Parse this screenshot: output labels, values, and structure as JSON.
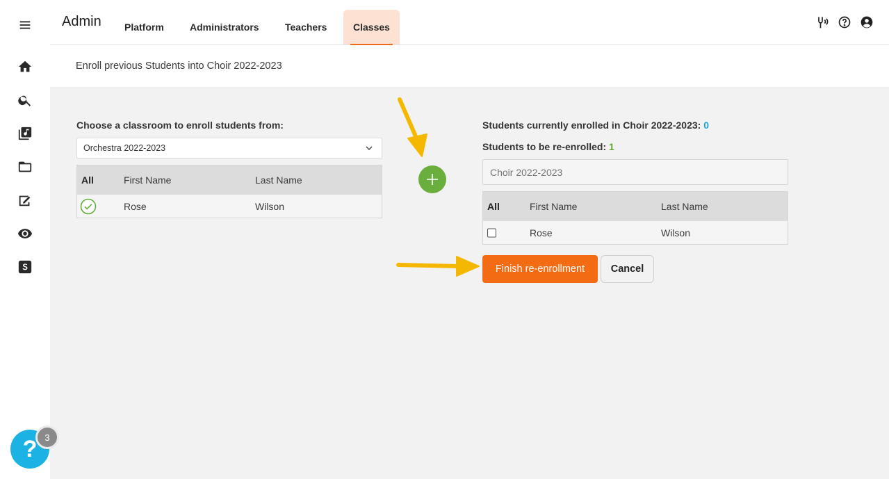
{
  "header": {
    "brand": "Admin",
    "tabs": [
      {
        "label": "Platform"
      },
      {
        "label": "Administrators"
      },
      {
        "label": "Teachers"
      },
      {
        "label": "Classes",
        "active": true
      }
    ],
    "icons": [
      "tuning-fork-icon",
      "help-circle-icon",
      "account-icon"
    ]
  },
  "sidebar": {
    "icons": [
      "menu-icon",
      "home-icon",
      "search-icon",
      "music-library-icon",
      "folder-icon",
      "assignment-icon",
      "eye-icon",
      "s-logo-icon"
    ]
  },
  "subheader": {
    "title": "Enroll previous Students into Choir 2022-2023"
  },
  "left_panel": {
    "heading": "Choose a classroom to enroll students from:",
    "select_value": "Orchestra 2022-2023",
    "table": {
      "headers": [
        "All",
        "First Name",
        "Last Name"
      ],
      "rows": [
        {
          "first": "Rose",
          "last": "Wilson",
          "selected": true
        }
      ]
    }
  },
  "right_panel": {
    "enrolled_label": "Students currently enrolled in Choir 2022-2023:",
    "enrolled_count": "0",
    "to_enroll_label": "Students to be re-enrolled:",
    "to_enroll_count": "1",
    "class_input_placeholder": "Choir 2022-2023",
    "table": {
      "headers": [
        "All",
        "First Name",
        "Last Name"
      ],
      "rows": [
        {
          "first": "Rose",
          "last": "Wilson",
          "checked": false
        }
      ]
    },
    "finish_label": "Finish re-enrollment",
    "cancel_label": "Cancel"
  },
  "help_widget": {
    "icon_text": "?",
    "badge_count": "3"
  },
  "colors": {
    "accent_orange": "#f36b12",
    "add_green": "#6aaf3d",
    "count_blue": "#1ca6d8",
    "count_green": "#5fa832",
    "help_blue": "#1cb3e4",
    "annotation_arrow": "#f5b800"
  }
}
